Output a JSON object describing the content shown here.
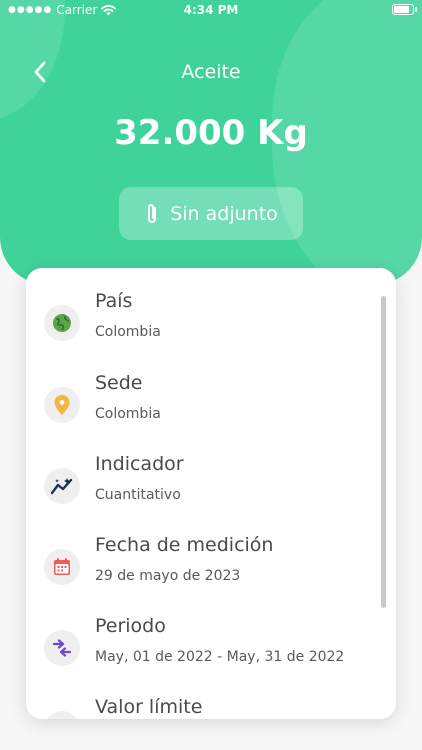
{
  "status_bar": {
    "carrier": "Carrier",
    "time": "4:34 PM",
    "battery_level": 0.9
  },
  "header": {
    "title": "Aceite",
    "amount": "32.000 Kg",
    "attachment_label": "Sin adjunto",
    "background_color": "#3fd39a"
  },
  "details": [
    {
      "label": "País",
      "value": "Colombia",
      "icon": "globe-icon",
      "icon_color": "#5aa548"
    },
    {
      "label": "Sede",
      "value": "Colombia",
      "icon": "location-pin-icon",
      "icon_color": "#f4b63f"
    },
    {
      "label": "Indicador",
      "value": "Cuantitativo",
      "icon": "trend-chart-icon",
      "icon_color": "#1f2f57"
    },
    {
      "label": "Fecha de medición",
      "value": "29 de mayo de 2023",
      "icon": "calendar-icon",
      "icon_color": "#ef5d56"
    },
    {
      "label": "Periodo",
      "value": "May, 01 de 2022 - May, 31 de 2022",
      "icon": "swap-arrows-icon",
      "icon_color": "#6c47d8"
    },
    {
      "label": "Valor límite",
      "value": "",
      "icon": "limit-icon",
      "icon_color": "#9a9a9a"
    }
  ]
}
